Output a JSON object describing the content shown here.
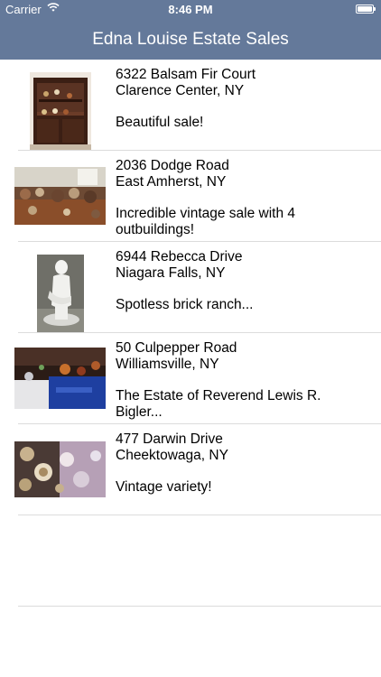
{
  "status": {
    "carrier": "Carrier",
    "time": "8:46 PM"
  },
  "nav": {
    "title": "Edna Louise Estate Sales"
  },
  "sales": [
    {
      "street": "6322 Balsam Fir Court",
      "city": "Clarence Center, NY",
      "desc": "Beautiful sale!",
      "photo": "hutch-photo"
    },
    {
      "street": "2036 Dodge Road",
      "city": "East Amherst, NY",
      "desc": "Incredible vintage sale with 4 outbuildings!",
      "photo": "room-photo"
    },
    {
      "street": "6944 Rebecca Drive",
      "city": "Niagara Falls, NY",
      "desc": "Spotless brick ranch...",
      "photo": "statue-photo"
    },
    {
      "street": "50 Culpepper Road",
      "city": "Williamsville, NY",
      "desc": "The Estate of Reverend Lewis R. Bigler...",
      "photo": "table-photo"
    },
    {
      "street": "477 Darwin Drive",
      "city": "Cheektowaga, NY",
      "desc": "Vintage variety!",
      "photo": "dishes-photo"
    }
  ]
}
